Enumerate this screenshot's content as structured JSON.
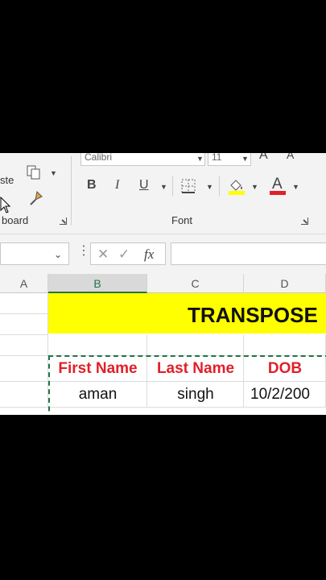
{
  "ribbon": {
    "clipboard": {
      "paste_label": "ste",
      "group_label": "board"
    },
    "font": {
      "font_name": "Calibri",
      "font_size": "11",
      "bold": "B",
      "italic": "I",
      "underline": "U",
      "group_label": "Font",
      "font_color_glyph": "A",
      "grow": "A",
      "shrink": "A"
    },
    "colors": {
      "fill": "#ffff00",
      "font_color": "#e0202a"
    }
  },
  "formula_bar": {
    "name_box": "",
    "fx": "fx",
    "content": ""
  },
  "columns": [
    "A",
    "B",
    "C",
    "D"
  ],
  "selected_column": "B",
  "sheet": {
    "title": "TRANSPOSE",
    "headers": [
      "First Name",
      "Last Name",
      "DOB"
    ],
    "rows": [
      [
        "aman",
        "singh",
        "10/2/200"
      ]
    ]
  }
}
